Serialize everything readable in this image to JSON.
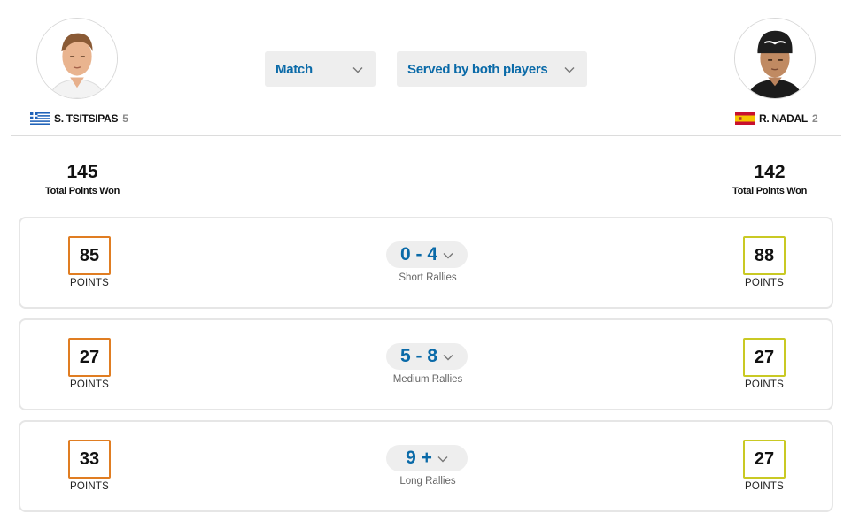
{
  "header": {
    "match_dropdown": "Match",
    "serve_dropdown": "Served by both players"
  },
  "players": {
    "left": {
      "name": "S. TSITSIPAS",
      "seed": "5",
      "flag": "greece-flag",
      "total_points": "145",
      "total_label": "Total Points Won"
    },
    "right": {
      "name": "R. NADAL",
      "seed": "2",
      "flag": "spain-flag",
      "total_points": "142",
      "total_label": "Total Points Won"
    }
  },
  "rallies": [
    {
      "range": "0 - 4",
      "name": "Short Rallies",
      "left_points": "85",
      "right_points": "88",
      "points_caption": "POINTS"
    },
    {
      "range": "5 - 8",
      "name": "Medium Rallies",
      "left_points": "27",
      "right_points": "27",
      "points_caption": "POINTS"
    },
    {
      "range": "9 +",
      "name": "Long Rallies",
      "left_points": "33",
      "right_points": "27",
      "points_caption": "POINTS"
    }
  ],
  "colors": {
    "accent_blue": "#0a6aa8",
    "left_player": "#e07d22",
    "right_player": "#c9c924"
  }
}
